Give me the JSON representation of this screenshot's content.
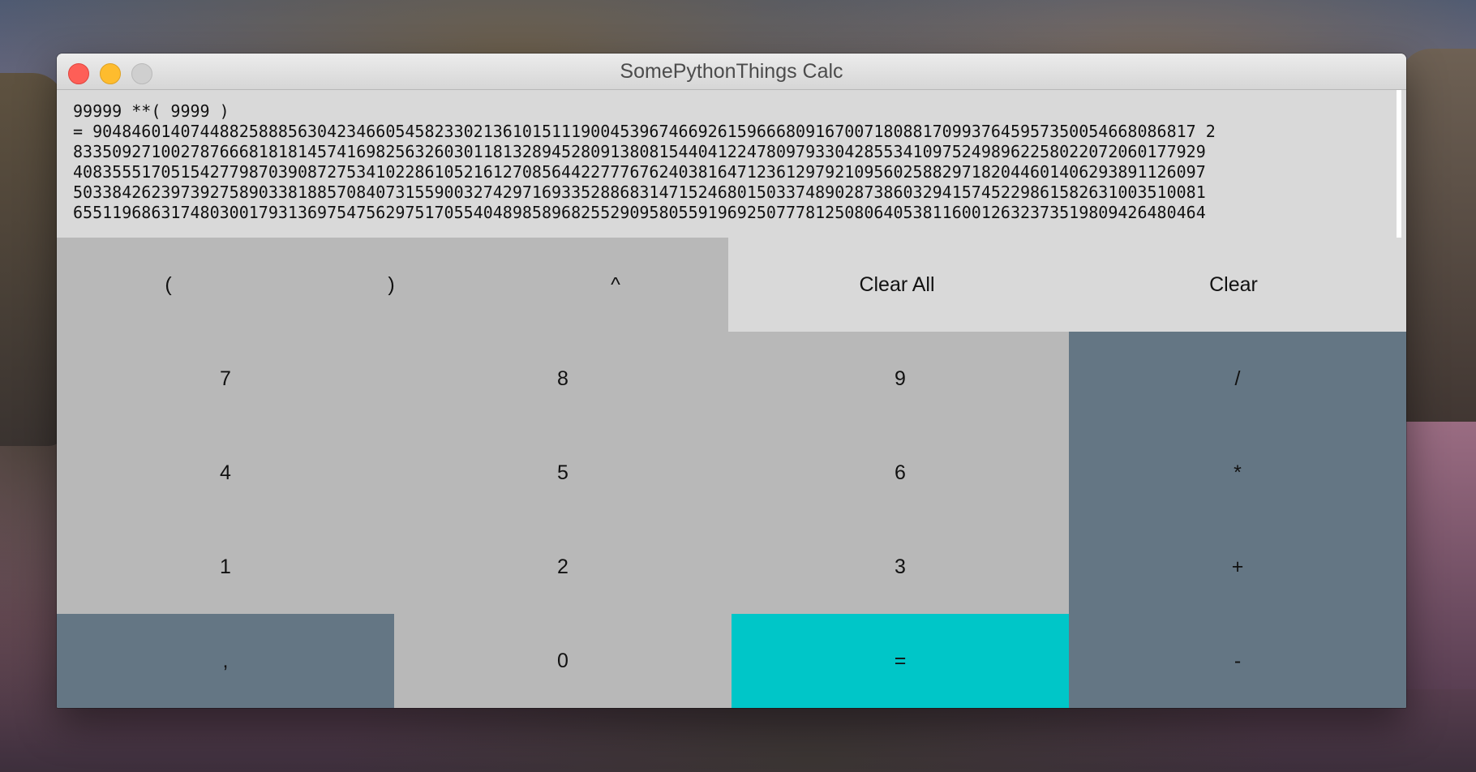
{
  "window": {
    "title": "SomePythonThings Calc"
  },
  "display": {
    "expression": "99999 **( 9999 )",
    "result_lines": [
      "= 90484601407448825888563042346605458233021361015111900453967466926159666809167007180881709937645957350054668086817 2",
      "83350927100278766681818145741698256326030118132894528091380815440412247809793304285534109752498962258022072060177929",
      "40835551705154277987039087275341022861052161270856442277767624038164712361297921095602588297182044601406293891126097",
      "50338426239739275890338188570840731559003274297169335288683147152468015033748902873860329415745229861582631003510081",
      "65511968631748030017931369754756297517055404898589682552909580559196925077781250806405381160012632373519809426480464"
    ]
  },
  "buttons": {
    "open_paren": "(",
    "close_paren": ")",
    "power": "^",
    "clear_all": "Clear All",
    "clear": "Clear",
    "seven": "7",
    "eight": "8",
    "nine": "9",
    "divide": "/",
    "four": "4",
    "five": "5",
    "six": "6",
    "multiply": "*",
    "one": "1",
    "two": "2",
    "three": "3",
    "plus": "+",
    "comma": ",",
    "zero": "0",
    "equals": "=",
    "minus": "-"
  },
  "colors": {
    "operator_button": "#647684",
    "equals_button": "#00c6c8",
    "number_button": "#b8b8b8",
    "clear_button": "#d9d9d9"
  }
}
